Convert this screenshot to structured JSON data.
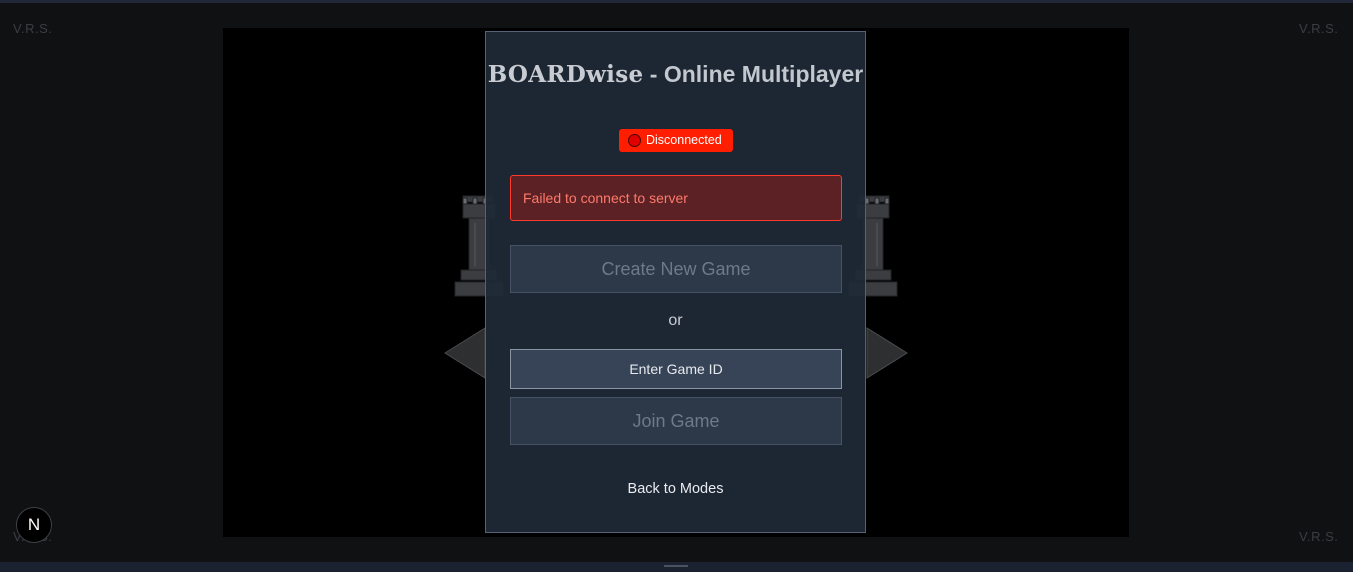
{
  "watermarks": {
    "top_left": "V.R.S.",
    "top_right": "V.R.S.",
    "bottom_left": "V.R.S.",
    "bottom_right": "V.R.S."
  },
  "modal": {
    "title_brand": "BOARDwise",
    "title_rest": " - Online Multiplayer",
    "status_label": "Disconnected",
    "status_color": "#ff1f00",
    "error_message": "Failed to connect to server",
    "create_button_label": "Create New Game",
    "or_label": "or",
    "game_id_placeholder": "Enter Game ID",
    "join_button_label": "Join Game",
    "back_link_label": "Back to Modes"
  },
  "dev_badge": {
    "letter": "N",
    "icon": "nextjs-logo-icon"
  }
}
